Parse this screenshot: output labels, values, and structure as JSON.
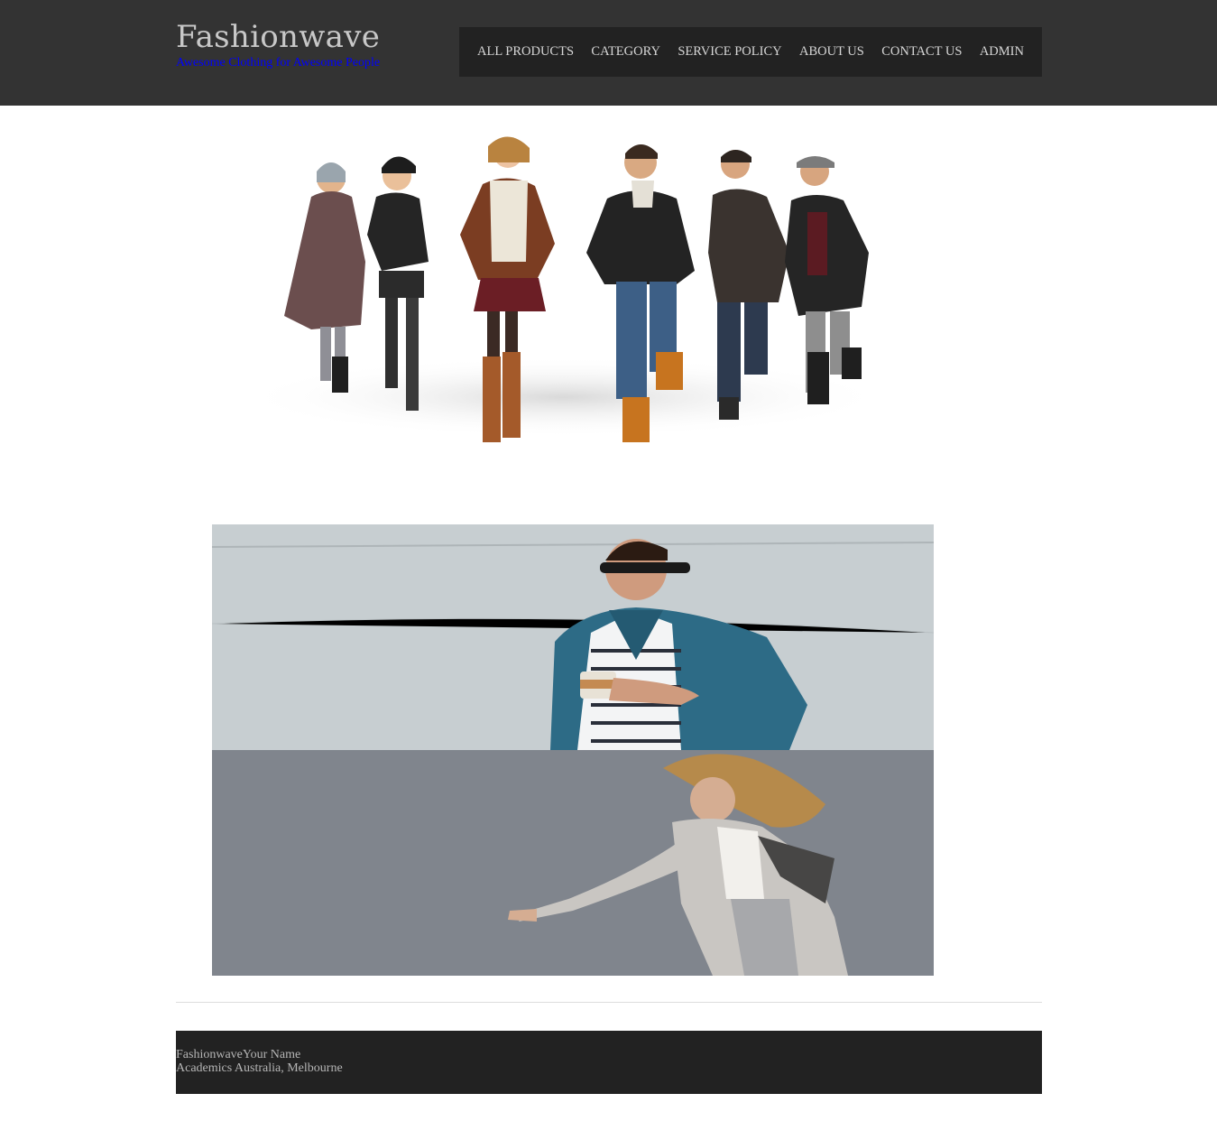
{
  "site": {
    "title": "Fashionwave",
    "tagline": "Awesome Clothing for Awesome People"
  },
  "nav": {
    "items": [
      {
        "label": "ALL PRODUCTS"
      },
      {
        "label": "CATEGORY"
      },
      {
        "label": "SERVICE POLICY"
      },
      {
        "label": "ABOUT US"
      },
      {
        "label": "CONTACT US"
      },
      {
        "label": "ADMIN"
      }
    ]
  },
  "footer": {
    "line1": "FashionwaveYour Name",
    "line2": "Academics Australia, Melbourne"
  },
  "colors": {
    "header_bg": "#333333",
    "nav_bg": "#222222",
    "tagline": "#0000ff",
    "footer_bg": "#222222"
  }
}
